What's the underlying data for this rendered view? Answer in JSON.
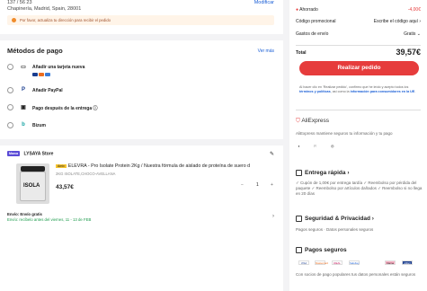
{
  "address": {
    "line1": "137 / 56 23",
    "line2": "Chapinería, Madrid, Spain, 28001",
    "modify": "Modificar",
    "warning": "Por favor, actualiza tu dirección para recibir el pedido"
  },
  "payment": {
    "title": "Métodos de pago",
    "see_more": "Ver más",
    "options": [
      {
        "label": "Añadir una tarjeta nueva",
        "icon": "card-icon"
      },
      {
        "label": "Añadir PayPal",
        "icon": "paypal-icon"
      },
      {
        "label": "Pago después de la entrega",
        "icon": "calendar-icon"
      },
      {
        "label": "Bizum",
        "icon": "bizum-icon"
      }
    ]
  },
  "store": {
    "badge": "Marca",
    "name": "LYSAYA Store",
    "product_brand": "Amix",
    "product_title": "ELEVRA - Pro Isolate Protein 2Kg / Nuestra fórmula de aislado de proteína de suero d",
    "product_variant": "2KG ISOLATE,CHOCO-AVELLANA",
    "jar_text": "ISOLA",
    "price": "43,57€",
    "qty_minus": "−",
    "qty": "1",
    "qty_plus": "+",
    "shipping": "Envío: Envío gratis",
    "delivery": "Envío: recíbelo antes del viernes, 11 - 13 de FEB"
  },
  "summary": {
    "saved_label": "Ahorrado",
    "saved_value": "-4,00€",
    "promo_label": "Código promocional",
    "promo_value": "Escribe el código aquí",
    "shipping_label": "Gastos de envío",
    "shipping_value": "Gratis",
    "total_label": "Total",
    "total_value": "39,57€",
    "order_button": "Realizar pedido",
    "legal_text": "Al hacer clic en 'Realizar pedido', confirmo que he leído y acepto todos los ",
    "legal_link1": "términos y políticas",
    "legal_mid": ", así como la ",
    "legal_link2": "información para consumidores en la UE",
    "legal_end": "."
  },
  "trust": {
    "aliexpress_title": "AliExpress",
    "aliexpress_sub": "AliExpress mantiene seguros tu información y tu pago",
    "delivery_title": "Entrega rápida",
    "delivery_sub": "✓ Cupón de 1,00€ por entrega tardía ✓ Reembolso por pérdida del paquete ✓ Reembolso por artículos dañados ✓ Reembolso si no llega en 20 días",
    "security_title": "Seguridad & Privacidad",
    "security_sub": "Pagos seguros · Datos personales seguros",
    "pay_title": "Pagos seguros",
    "pay_sub": "Con socios de pago populares tus datos personales están seguros",
    "pay_logos": [
      "VISA",
      "Mastercard",
      "iDEAL",
      "SafeKey",
      "Klarna",
      "AMEX"
    ]
  },
  "colors": {
    "accent": "#e63c3c",
    "link": "#1a5fd6",
    "success": "#1a9a4a"
  }
}
